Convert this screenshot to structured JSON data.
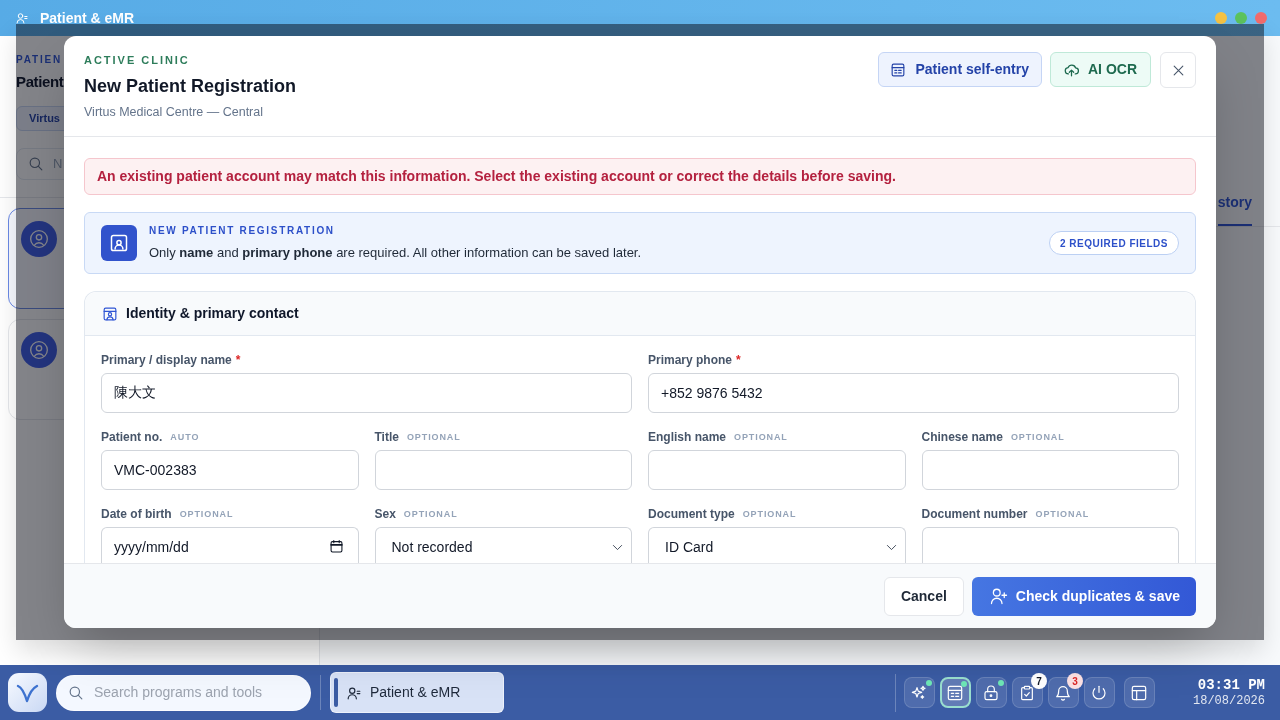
{
  "window": {
    "title": "Patient & eMR"
  },
  "background_app": {
    "section_label": "PATIEN",
    "heading": "Patient",
    "clinic_chip": "Virtus",
    "search": {
      "placeholder": "N"
    },
    "patients": [
      {
        "selected": true
      },
      {
        "selected": false
      }
    ],
    "tab": {
      "label": "story",
      "selected": true
    }
  },
  "modal": {
    "eyebrow": "ACTIVE CLINIC",
    "title": "New Patient Registration",
    "subtitle": "Virtus Medical Centre — Central",
    "self_entry_button": {
      "label": "Patient self-entry"
    },
    "ocr_button": {
      "label": "AI OCR"
    },
    "alert": "An existing patient account may match this information. Select the existing account or correct the details before saving.",
    "notice": {
      "title": "NEW PATIENT REGISTRATION",
      "text": "Only **name** and **primary phone** are required. All other information can be saved later.",
      "badge": "2 REQUIRED FIELDS"
    },
    "section": {
      "title": "Identity & primary contact",
      "required_mark": "*",
      "primary_fields": [
        {
          "label": "Primary / display name",
          "required": true,
          "kind": "text",
          "value": "陳大文"
        },
        {
          "label": "Primary phone",
          "required": true,
          "kind": "text",
          "value": "+852 9876 5432"
        }
      ],
      "detail_fields": [
        {
          "label": "Patient no.",
          "hint": "AUTO",
          "required": false,
          "kind": "text",
          "value": "VMC-002383"
        },
        {
          "label": "Title",
          "hint": "OPTIONAL",
          "required": false,
          "kind": "text"
        },
        {
          "label": "English name",
          "hint": "OPTIONAL",
          "required": false,
          "kind": "text"
        },
        {
          "label": "Chinese name",
          "hint": "OPTIONAL",
          "required": false,
          "kind": "text"
        },
        {
          "label": "Date of birth",
          "hint": "OPTIONAL",
          "required": false,
          "kind": "date",
          "placeholder": "yyyy/mm/dd"
        },
        {
          "label": "Sex",
          "hint": "OPTIONAL",
          "required": false,
          "kind": "select",
          "value": "Not recorded"
        },
        {
          "label": "Document type",
          "hint": "OPTIONAL",
          "required": false,
          "kind": "select",
          "value": "ID Card"
        },
        {
          "label": "Document number",
          "hint": "OPTIONAL",
          "required": false,
          "kind": "text"
        }
      ]
    },
    "footer": {
      "cancel": "Cancel",
      "save": "Check duplicates & save"
    }
  },
  "taskbar": {
    "search": {
      "placeholder": "Search programs and tools"
    },
    "apps": [
      {
        "label": "Patient & eMR",
        "selected": true
      }
    ],
    "tray": [
      {
        "selected": false,
        "indicator": true
      },
      {
        "selected": true,
        "indicator": true
      },
      {
        "selected": false,
        "indicator": true
      },
      {
        "selected": false,
        "indicator": false,
        "badge": "7",
        "alert": false
      },
      {
        "selected": false,
        "indicator": false,
        "badge": "3",
        "alert": true
      },
      {
        "selected": false,
        "indicator": false
      },
      {
        "selected": false,
        "indicator": false
      }
    ],
    "time": "03:31 PM",
    "date": "18/08/2026"
  }
}
